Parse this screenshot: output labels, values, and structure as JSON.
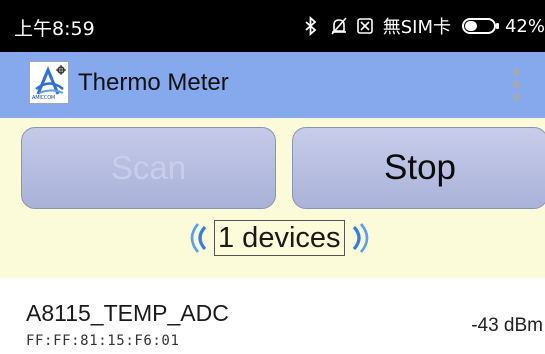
{
  "status_bar": {
    "time": "上午8:59",
    "carrier": "無SIM卡",
    "battery_text": "42%",
    "battery_level": 0.42,
    "icons": [
      "bluetooth-icon",
      "mute-icon",
      "no-sim-icon",
      "battery-icon"
    ]
  },
  "app_bar": {
    "logo_caption": "AMICCOM",
    "title": "Thermo Meter",
    "overflow_icon": "more-vert-icon",
    "background": "#86a9ee"
  },
  "controls": {
    "scan_label": "Scan",
    "stop_label": "Stop",
    "device_count": "1 devices",
    "panel_color": "#fbfbd9",
    "signal_icon_color": "#2f7fe6"
  },
  "devices": [
    {
      "name": "A8115_TEMP_ADC",
      "mac": "FF:FF:81:15:F6:01",
      "rssi": "-43 dBm"
    }
  ]
}
